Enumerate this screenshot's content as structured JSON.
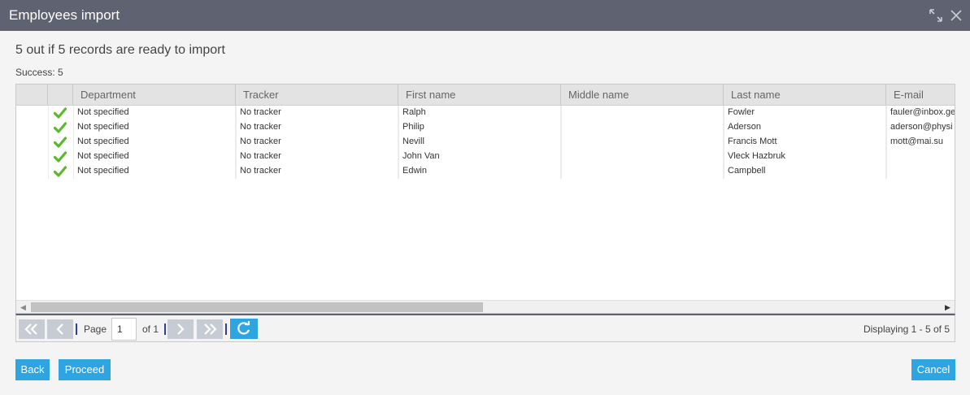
{
  "window": {
    "title": "Employees import"
  },
  "summary": {
    "headline": "5 out if 5 records are ready to import",
    "success": "Success: 5"
  },
  "grid": {
    "columns": [
      "Department",
      "Tracker",
      "First name",
      "Middle name",
      "Last name",
      "E-mail"
    ],
    "rows": [
      {
        "status": "ok",
        "department": "Not specified",
        "tracker": "No tracker",
        "first_name": "Ralph",
        "middle_name": "",
        "last_name": "Fowler",
        "email": "fauler@inbox.ge"
      },
      {
        "status": "ok",
        "department": "Not specified",
        "tracker": "No tracker",
        "first_name": "Philip",
        "middle_name": "",
        "last_name": "Aderson",
        "email": "aderson@physi"
      },
      {
        "status": "ok",
        "department": "Not specified",
        "tracker": "No tracker",
        "first_name": "Nevill",
        "middle_name": "",
        "last_name": "Francis Mott",
        "email": "mott@mai.su"
      },
      {
        "status": "ok",
        "department": "Not specified",
        "tracker": "No tracker",
        "first_name": "John Van",
        "middle_name": "",
        "last_name": "Vleck Hazbruk",
        "email": ""
      },
      {
        "status": "ok",
        "department": "Not specified",
        "tracker": "No tracker",
        "first_name": "Edwin",
        "middle_name": "",
        "last_name": "Campbell",
        "email": ""
      }
    ],
    "status_icon": "check-icon",
    "status_color": "#5cb82e"
  },
  "pager": {
    "page_label": "Page",
    "page_value": "1",
    "of_label": "of 1",
    "display_text": "Displaying 1 - 5 of 5",
    "icons": [
      "first-page-icon",
      "prev-page-icon",
      "next-page-icon",
      "last-page-icon",
      "refresh-icon"
    ]
  },
  "buttons": {
    "back": "Back",
    "proceed": "Proceed",
    "cancel": "Cancel"
  },
  "colors": {
    "titlebar": "#5f6270",
    "accent": "#2ea4e0"
  }
}
